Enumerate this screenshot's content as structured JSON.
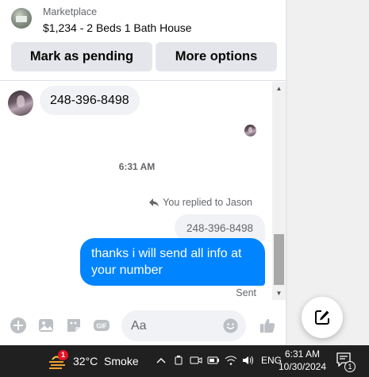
{
  "header": {
    "marketplace_label": "Marketplace",
    "listing_title": "$1,234 - 2 Beds 1 Bath House",
    "mark_pending_label": "Mark as pending",
    "more_options_label": "More options"
  },
  "messages": {
    "incoming_text": "248-396-8498",
    "timestamp": "6:31 AM",
    "reply_note": "You replied to Jason",
    "quoted_text": "248-396-8498",
    "outgoing_text": "thanks i will send all info at your number",
    "status": "Sent"
  },
  "composer": {
    "placeholder": "Aa",
    "icons": [
      "plus-circle-icon",
      "image-icon",
      "sticker-icon",
      "gif-icon",
      "emoji-icon",
      "thumbs-up-icon"
    ]
  },
  "taskbar": {
    "weather_badge": "1",
    "weather_text": "32°C  Smoke",
    "language": "ENG",
    "time": "6:31 AM",
    "date": "10/30/2024",
    "notification_count": "1"
  },
  "colors": {
    "accent": "#0084ff",
    "bubble_gray": "#f0f2f5",
    "button_gray": "#e4e6eb",
    "taskbar": "#202020"
  }
}
